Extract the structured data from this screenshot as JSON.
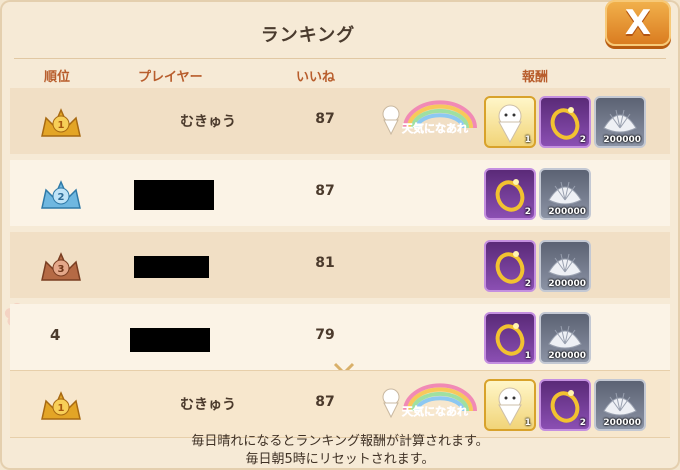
{
  "header": {
    "title": "ランキング",
    "close_label": "X"
  },
  "columns": {
    "rank": "順位",
    "player": "プレイヤー",
    "likes": "いいね",
    "reward": "報酬"
  },
  "rows": [
    {
      "rank": "1",
      "player": "むきゅう",
      "likes": "87",
      "title_badge": "天気になあれ",
      "rewards": [
        {
          "icon": "teru-teru-doll",
          "count": "1"
        },
        {
          "icon": "ring",
          "count": "2"
        },
        {
          "icon": "shell",
          "count": "200000"
        }
      ]
    },
    {
      "rank": "2",
      "player": "",
      "likes": "87",
      "rewards": [
        {
          "icon": "ring",
          "count": "2"
        },
        {
          "icon": "shell",
          "count": "200000"
        }
      ]
    },
    {
      "rank": "3",
      "player": "",
      "likes": "81",
      "rewards": [
        {
          "icon": "ring",
          "count": "2"
        },
        {
          "icon": "shell",
          "count": "200000"
        }
      ]
    },
    {
      "rank": "4",
      "player": "",
      "likes": "79",
      "rewards": [
        {
          "icon": "ring",
          "count": "1"
        },
        {
          "icon": "shell",
          "count": "200000"
        }
      ]
    }
  ],
  "my_row": {
    "rank": "1",
    "player": "むきゅう",
    "likes": "87",
    "title_badge": "天気になあれ",
    "rewards": [
      {
        "icon": "teru-teru-doll",
        "count": "1"
      },
      {
        "icon": "ring",
        "count": "2"
      },
      {
        "icon": "shell",
        "count": "200000"
      }
    ]
  },
  "footer": {
    "line1": "毎日晴れになるとランキング報酬が計算されます。",
    "line2": "毎日朝5時にリセットされます。"
  },
  "colors": {
    "header_text": "#b85d2c",
    "gold": "#e3a526",
    "silver": "#6fb7e0",
    "bronze": "#b56a45"
  }
}
